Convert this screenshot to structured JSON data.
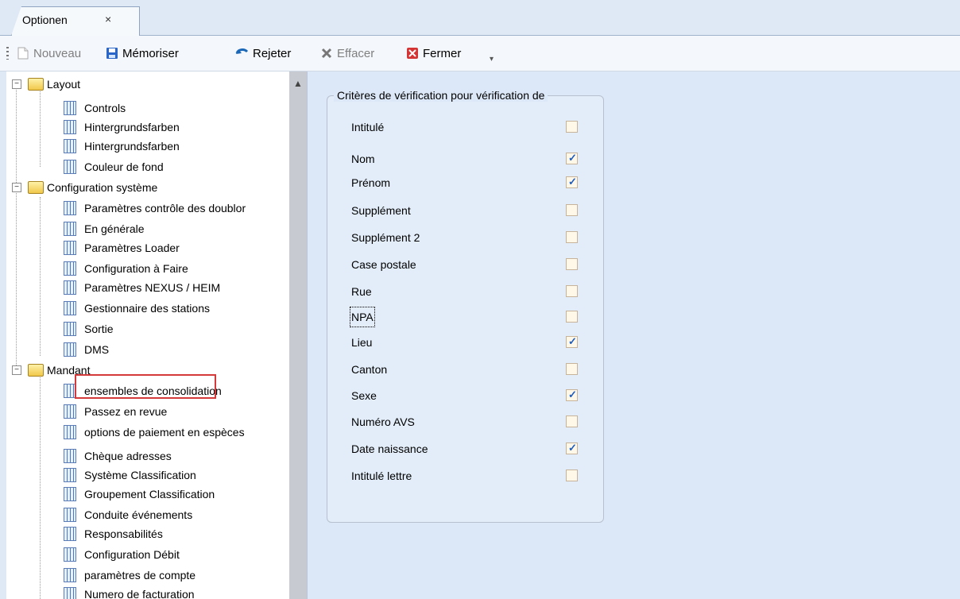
{
  "tab": {
    "title": "Optionen",
    "close": "×"
  },
  "toolbar": {
    "new": "Nouveau",
    "save": "Mémoriser",
    "reject": "Rejeter",
    "delete": "Effacer",
    "close": "Fermer"
  },
  "tree": {
    "groups": [
      {
        "label": "Layout",
        "items": [
          "Controls",
          "Hintergrundsfarben",
          "Hintergrundsfarben",
          "Couleur de fond"
        ]
      },
      {
        "label": "Configuration système",
        "items": [
          "Paramètres contrôle des doublor",
          "En générale",
          "Paramètres Loader",
          "Configuration à Faire",
          "Paramètres NEXUS / HEIM",
          "Gestionnaire des stations",
          "Sortie",
          "DMS"
        ]
      },
      {
        "label": "Mandant",
        "items": [
          "ensembles de consolidation",
          "Passez en revue",
          "options de paiement en espèces",
          "Chèque adresses",
          "Système Classification",
          "Groupement Classification",
          "Conduite événements",
          "Responsabilités",
          "Configuration Débit",
          "paramètres de compte",
          "Numero de facturation"
        ]
      }
    ]
  },
  "form": {
    "legend": "Critères de vérification pour vérification de",
    "fields": [
      {
        "label": "Intitulé",
        "checked": false
      },
      {
        "label": "Nom",
        "checked": true
      },
      {
        "label": "Prénom",
        "checked": true
      },
      {
        "label": "Supplément",
        "checked": false
      },
      {
        "label": "Supplément 2",
        "checked": false
      },
      {
        "label": "Case postale",
        "checked": false
      },
      {
        "label": "Rue",
        "checked": false
      },
      {
        "label": "NPA",
        "checked": false
      },
      {
        "label": "Lieu",
        "checked": true
      },
      {
        "label": "Canton",
        "checked": false
      },
      {
        "label": "Sexe",
        "checked": true
      },
      {
        "label": "Numéro  AVS",
        "checked": false
      },
      {
        "label": "Date naissance",
        "checked": true
      },
      {
        "label": "Intitulé lettre",
        "checked": false
      }
    ]
  }
}
